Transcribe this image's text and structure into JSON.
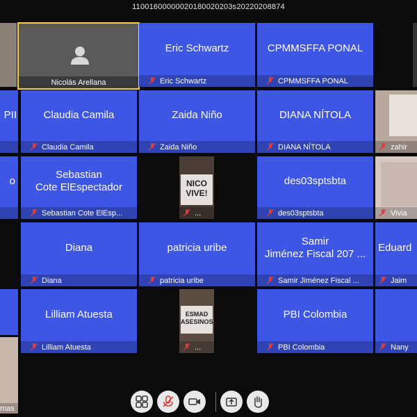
{
  "window": {
    "title": "11001600000020180020203s20220208874"
  },
  "colors": {
    "tile": "#3d56e6",
    "highlight": "#f1d24a"
  },
  "tiles": {
    "nicolas": {
      "label": "Nicolás Arellana"
    },
    "eric": {
      "name": "Eric Schwartz",
      "label": "Eric Schwartz"
    },
    "cpmm": {
      "name": "CPMMSFFA PONAL",
      "label": "CPMMSFFA PONAL"
    },
    "claudia": {
      "name": "Claudia Camila",
      "label": "Claudia Camila"
    },
    "zaida": {
      "name": "Zaida Niño",
      "label": "Zaida Niño"
    },
    "diana_n": {
      "name": "DIANA NÍTOLA",
      "label": "DIANA NÍTOLA"
    },
    "zahir": {
      "label": "zahir"
    },
    "sebastian": {
      "name_line1": "Sebastian",
      "name_line2": "Cote ElEspectador",
      "label": "Sebastian Cote ElEsp..."
    },
    "sign1": {
      "sign_text": "NICO VIVE!",
      "label": "..."
    },
    "des03": {
      "name": "des03sptsbta",
      "label": "des03sptsbta"
    },
    "vivia": {
      "label": "Vivia"
    },
    "diana": {
      "name": "Diana",
      "label": "Diana"
    },
    "patricia": {
      "name": "patricia uribe",
      "label": "patricia uribe"
    },
    "samir": {
      "name_line1": "Samir",
      "name_line2": "Jiménez Fiscal 207 ...",
      "label": "Samir Jiménez Fiscal ..."
    },
    "eduard": {
      "name": "Eduard",
      "label": "Jaim"
    },
    "lilliam": {
      "name": "Lilliam Atuesta",
      "label": "Lilliam Atuesta"
    },
    "sign2": {
      "sign_text": "ESMAD ASESINOS",
      "label": "..."
    },
    "pbi": {
      "name": "PBI Colombia",
      "label": "PBI Colombia"
    },
    "nany": {
      "label": "Nany"
    },
    "left_pii": {
      "name": "PII"
    },
    "left_o": {
      "name": "o"
    },
    "left_mas": {
      "label": "mas"
    }
  },
  "toolbar": {
    "icons": [
      "gallery-view-icon",
      "mic-muted-icon",
      "video-camera-icon",
      "share-screen-icon",
      "raise-hand-icon"
    ]
  }
}
